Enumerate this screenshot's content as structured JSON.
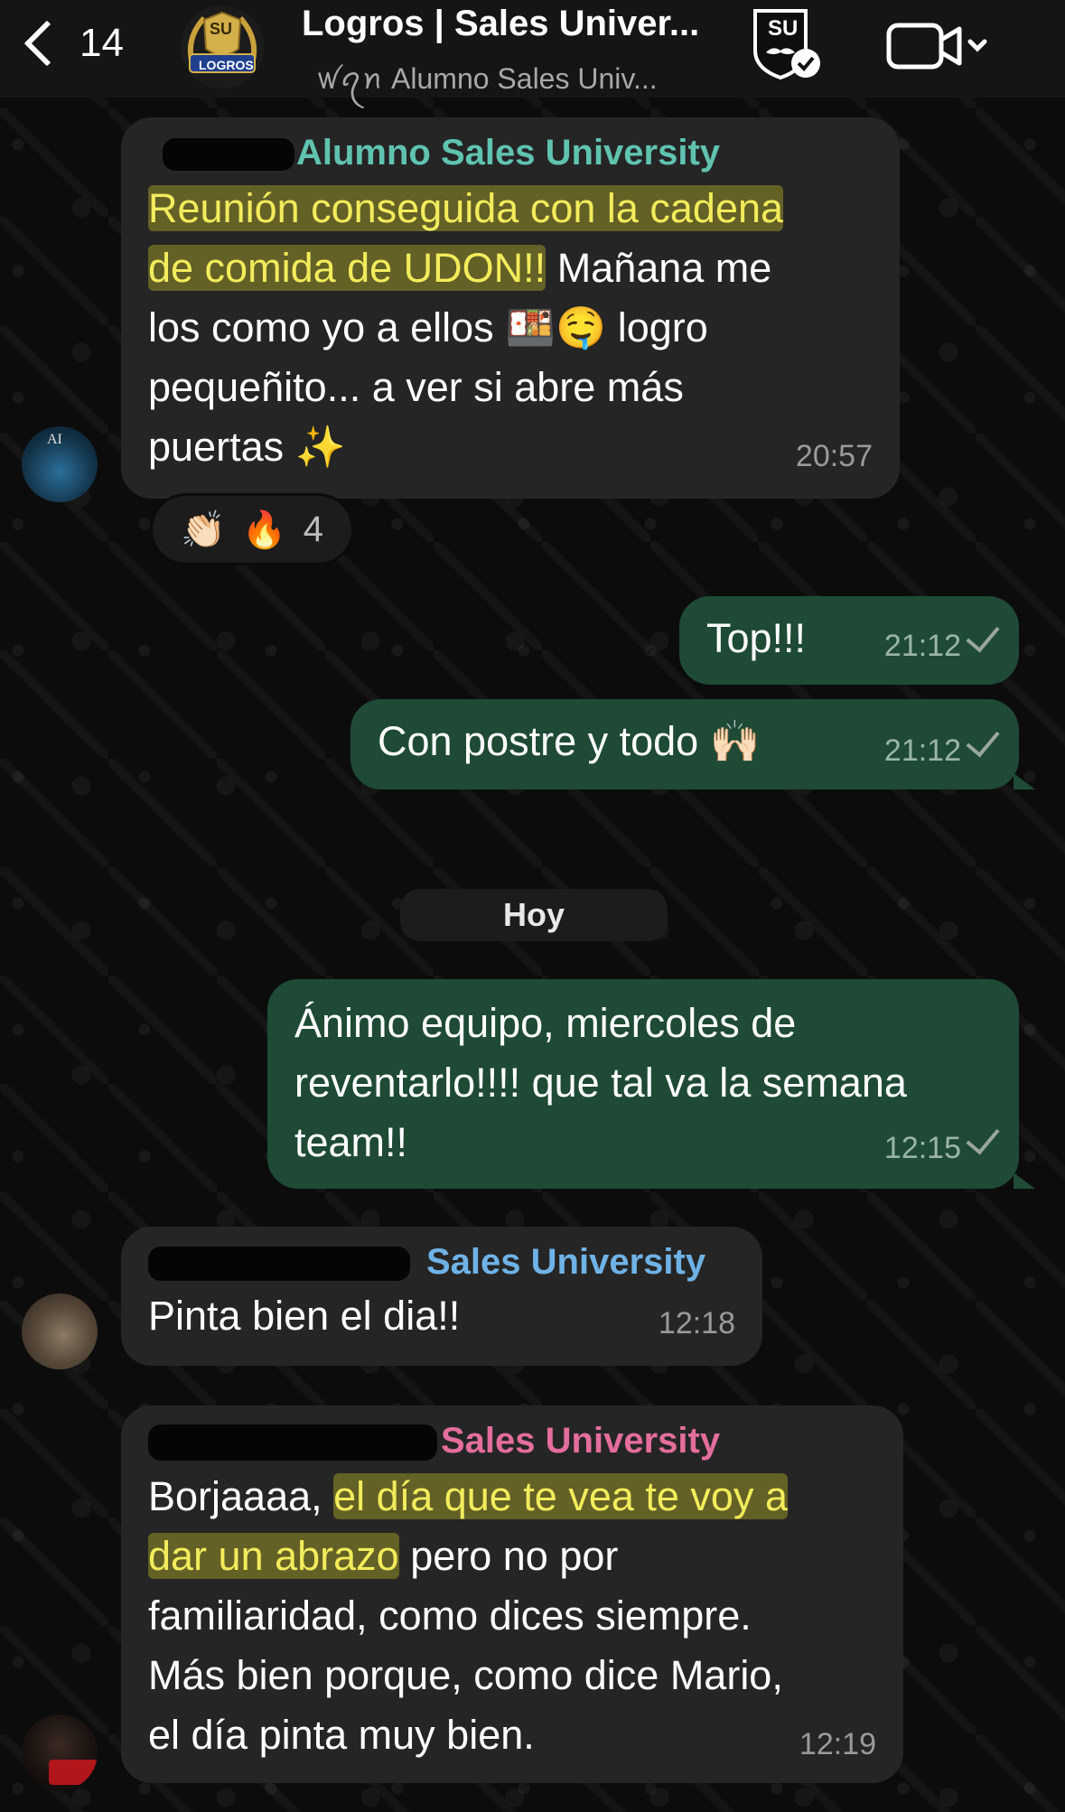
{
  "header": {
    "back_count": "14",
    "group_logo_text": "LOGROS",
    "group_logo_badge": "SU",
    "title": "Logros | Sales Univer...",
    "subtitle": "ꪝꪖꪀ Alumno Sales Univ...",
    "badge_text": "SU"
  },
  "messages": [
    {
      "sender": "Alumno Sales University",
      "sender_color": "#5fc3b0",
      "highlight_1": "Reunión conseguida con la cadena",
      "highlight_2": "de comida de UDON!!",
      "text_2_rest": " Mañana me",
      "line_3": "los como yo a ellos 🍱🤤 logro",
      "line_4": "pequeñito... a ver si abre más",
      "line_5": "puertas ✨",
      "time": "20:57",
      "avatar_initials": "AI"
    },
    {
      "text": "Top!!!",
      "time": "21:12"
    },
    {
      "text": "Con postre y todo 🙌🏻",
      "time": "21:12"
    },
    {
      "line_1": "Ánimo equipo, miercoles de",
      "line_2": "reventarlo!!!! que tal va la semana",
      "line_3": "team!!",
      "time": "12:15"
    },
    {
      "sender": "Sales University",
      "sender_color": "#6fb2e6",
      "text": "Pinta bien el dia!!",
      "time": "12:18"
    },
    {
      "sender": "Sales University",
      "sender_color": "#e36d9c",
      "line_1_plain": "Borjaaaa, ",
      "line_1_hl": "el día que te vea te voy a",
      "line_2_hl": "dar un abrazo",
      "line_2_plain": " pero no por",
      "line_3": "familiaridad, como dices siempre.",
      "line_4": "Más bien porque, como dice Mario,",
      "line_5": "el día pinta muy bien.",
      "time": "12:19"
    }
  ],
  "reactions": {
    "emoji_1": "👏🏻",
    "emoji_2": "🔥",
    "count": "4"
  },
  "date_separator": "Hoy"
}
